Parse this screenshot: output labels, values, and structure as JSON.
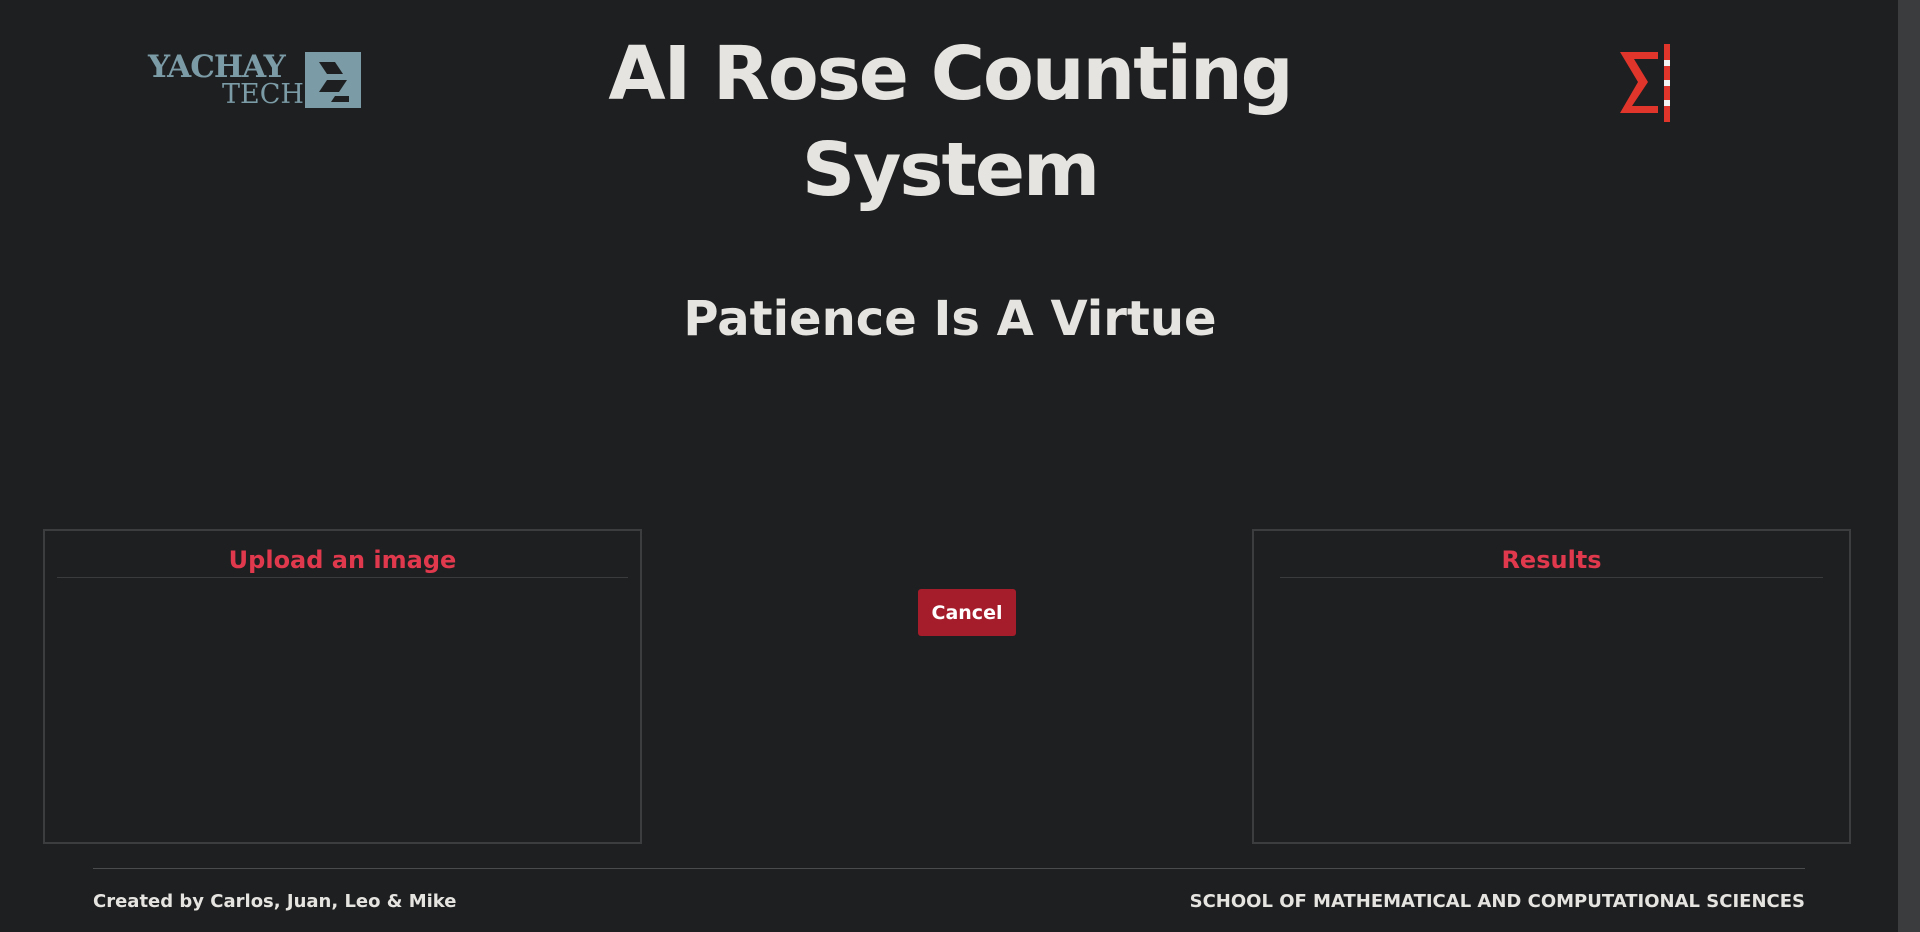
{
  "header": {
    "title": "AI Rose Counting System",
    "left_logo": {
      "word1": "YACHAY",
      "word2": "TECH",
      "icon": "yachay-tech-logo",
      "color": "#7b9ba6"
    },
    "right_logo": {
      "icon": "sigma-logo",
      "color": "#e0352b"
    }
  },
  "status": {
    "message": "Patience Is A Virtue"
  },
  "upload_panel": {
    "title": "Upload an image"
  },
  "results_panel": {
    "title": "Results"
  },
  "actions": {
    "cancel_label": "Cancel"
  },
  "footer": {
    "credits": "Created by Carlos, Juan, Leo & Mike",
    "school": "SCHOOL OF MATHEMATICAL AND COMPUTATIONAL SCIENCES"
  },
  "colors": {
    "background": "#1e1f20",
    "accent": "#e0384c",
    "button": "#a51c2a",
    "text": "#e6e4e1"
  }
}
